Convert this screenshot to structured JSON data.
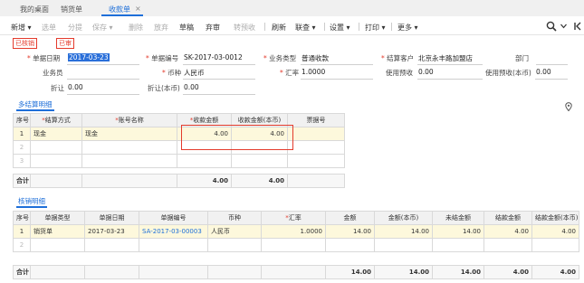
{
  "tabs": [
    {
      "label": "我的桌面"
    },
    {
      "label": "销货单"
    },
    {
      "label": "收款单",
      "close": "×"
    }
  ],
  "toolbar": {
    "new": "新增 ▾",
    "select": "选单",
    "split": "分提",
    "save": "保存 ▾",
    "delete": "删除",
    "abandon": "放弃",
    "draft": "草稿",
    "void": "弃审",
    "transfer_prepay": "转预收",
    "refresh": "刷新",
    "query": "联查 ▾",
    "settings": "设置 ▾",
    "print": "打印 ▾",
    "more": "更多 ▾"
  },
  "status": {
    "verified": "已核销",
    "audited": "已审"
  },
  "form": {
    "date_label": "单据日期",
    "date_value": "2017-03-23",
    "code_label": "单据编号",
    "code_value": "SK-2017-03-0012",
    "biz_type_label": "业务类型",
    "biz_type_value": "普通收款",
    "customer_label": "结算客户",
    "customer_value": "北京永丰路加盟店",
    "dept_label": "部门",
    "dept_value": "",
    "salesman_label": "业务员",
    "salesman_value": "",
    "currency_label": "币种",
    "currency_value": "人民币",
    "rate_label": "汇率",
    "rate_value": "1.0000",
    "use_prepay_label": "使用预收",
    "use_prepay_value": "0.00",
    "use_prepay_local_label": "使用预收(本币)",
    "use_prepay_local_value": "0.00",
    "discount_label": "折让",
    "discount_value": "0.00",
    "discount_local_label": "折让(本币)",
    "discount_local_value": "0.00"
  },
  "settle": {
    "title": "多结算明细",
    "headers": [
      "序号",
      "结算方式",
      "账号名称",
      "收款金额",
      "收款金额(本币)",
      "票据号"
    ],
    "rows": [
      {
        "idx": "1",
        "method": "现金",
        "account": "现金",
        "amount": "4.00",
        "amount_local": "4.00",
        "bill": ""
      },
      {
        "idx": "2",
        "method": "",
        "account": "",
        "amount": "",
        "amount_local": "",
        "bill": ""
      },
      {
        "idx": "3",
        "method": "",
        "account": "",
        "amount": "",
        "amount_local": "",
        "bill": ""
      }
    ],
    "total_label": "合计",
    "total_amount": "4.00",
    "total_amount_local": "4.00"
  },
  "verify": {
    "title": "核销明细",
    "headers": [
      "序号",
      "单据类型",
      "单据日期",
      "单据编号",
      "币种",
      "汇率",
      "金额",
      "金额(本币)",
      "未结金额",
      "结款金额",
      "结款金额(本币)"
    ],
    "rows": [
      {
        "idx": "1",
        "type": "销货单",
        "date": "2017-03-23",
        "code": "SA-2017-03-00003",
        "currency": "人民币",
        "rate": "1.0000",
        "amount": "14.00",
        "amount_local": "14.00",
        "unsettled": "14.00",
        "settle": "4.00",
        "settle_local": "4.00"
      },
      {
        "idx": "2",
        "type": "",
        "date": "",
        "code": "",
        "currency": "",
        "rate": "",
        "amount": "",
        "amount_local": "",
        "unsettled": "",
        "settle": "",
        "settle_local": ""
      }
    ],
    "total_label": "合计",
    "total_amount": "14.00",
    "total_amount_local": "14.00",
    "total_unsettled": "14.00",
    "total_settle": "4.00",
    "total_settle_local": "4.00"
  }
}
